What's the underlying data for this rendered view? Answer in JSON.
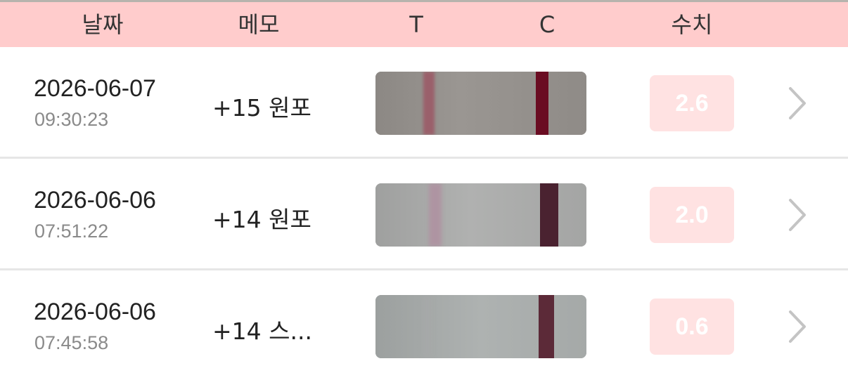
{
  "header": {
    "date_label": "날짜",
    "memo_label": "메모",
    "t_label": "T",
    "c_label": "C",
    "value_label": "수치",
    "background": "#ffcccc"
  },
  "rows": [
    {
      "date": "2026-06-07",
      "time": "09:30:23",
      "memo": "+15 원포",
      "value": "2.6",
      "strip": {
        "base": "#8e8a86",
        "t_line": "#9c5865",
        "c_line": "#6a0c22"
      }
    },
    {
      "date": "2026-06-06",
      "time": "07:51:22",
      "memo": "+14 원포",
      "value": "2.0",
      "strip": {
        "base": "#a3a4a3",
        "t_line": "#b08fa0",
        "c_line": "#4a2230"
      }
    },
    {
      "date": "2026-06-06",
      "time": "07:45:58",
      "memo": "+14 스...",
      "value": "0.6",
      "strip": {
        "base": "#a1a5a4",
        "t_line": "#a7a9a9",
        "c_line": "#5c2a38"
      }
    }
  ],
  "icons": {
    "row_chevron": "chevron-right-icon"
  },
  "colors": {
    "score_badge": "#ffe2e2",
    "chevron": "#c4c4c4",
    "separator": "#e6e6e6"
  }
}
